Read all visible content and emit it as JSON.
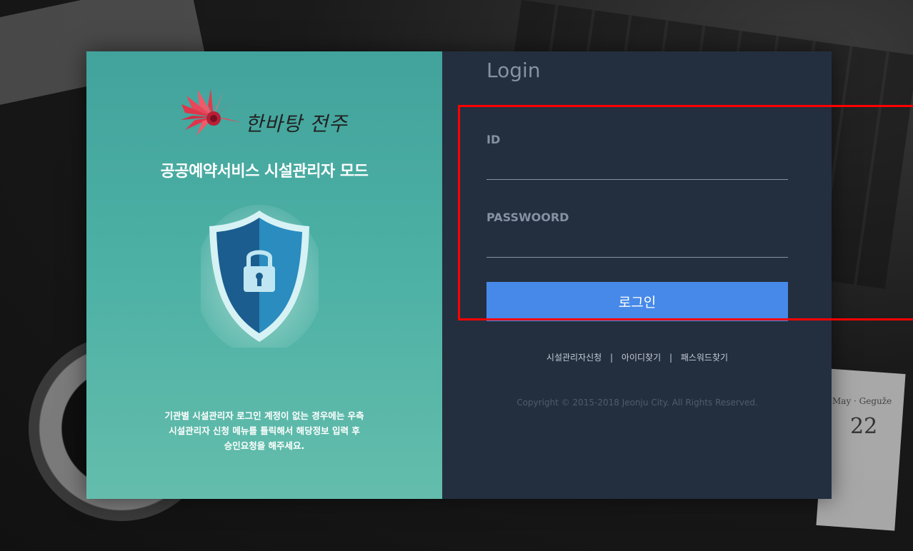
{
  "brand": {
    "logo_script": "한바탕 전주",
    "service_title": "공공예약서비스 시설관리자 모드",
    "notice_lines": [
      "기관별 시설관리자 로그인 계정이 없는 경우에는 우측",
      "시설관리자 신청 메뉴를 틀릭해서 해당정보 입력 후",
      "승인요청을 해주세요."
    ]
  },
  "login": {
    "title": "Login",
    "id_label": "ID",
    "id_value": "",
    "password_label": "PASSWOORD",
    "password_value": "",
    "submit_label": "로그인",
    "links": [
      "시설관리자신청",
      "아이디찾기",
      "패스워드찾기"
    ],
    "link_separator": "|",
    "copyright": "Copyright © 2015-2018 Jeonju City. All Rights Reserved."
  },
  "background": {
    "notebook_text": "May · Geguže",
    "notebook_number": "22"
  },
  "colors": {
    "left_panel": "#4db1a5",
    "right_panel": "#232f3f",
    "button": "#4789e8",
    "label": "#8592a3",
    "highlight": "#ff0000"
  },
  "icons": {
    "logo": "red-flower-logo",
    "shield": "shield-lock-icon"
  }
}
